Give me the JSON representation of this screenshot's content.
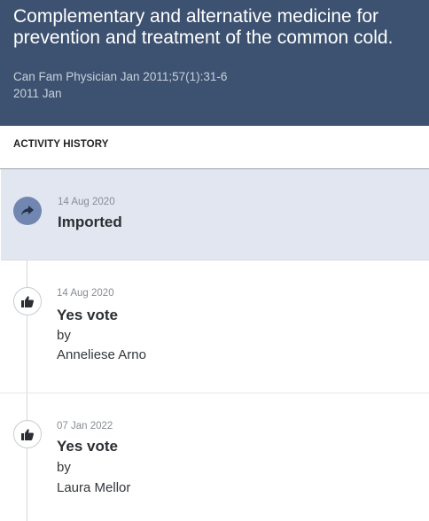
{
  "record": {
    "title": "Complementary and alternative medicine for prevention and treatment of the common cold.",
    "citation": "Can Fam Physician Jan 2011;57(1):31-6",
    "pub_date": "2011 Jan"
  },
  "activity": {
    "heading": "ACTIVITY HISTORY",
    "entries": [
      {
        "date": "14 Aug 2020",
        "action": "Imported",
        "icon": "share-arrow-icon"
      },
      {
        "date": "14 Aug 2020",
        "action": "Yes vote",
        "by": "by",
        "actor": "Anneliese Arno",
        "icon": "thumbs-up-icon"
      },
      {
        "date": "07 Jan 2022",
        "action": "Yes vote",
        "by": "by",
        "actor": "Laura Mellor",
        "icon": "thumbs-up-icon"
      }
    ]
  },
  "colors": {
    "header_bg": "#3d5270",
    "highlight_bg": "#e1e6f0",
    "badge_accent": "#7186b0"
  }
}
